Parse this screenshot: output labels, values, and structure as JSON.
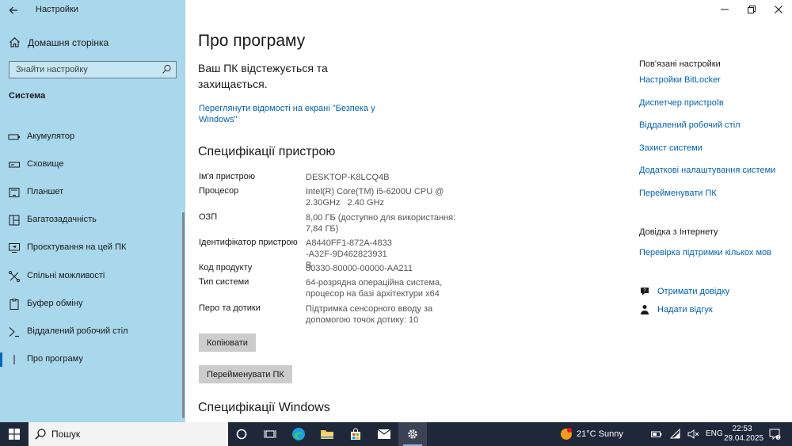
{
  "window": {
    "app_title": "Настройки",
    "controls": [
      "minimize",
      "restore",
      "close"
    ]
  },
  "sidebar": {
    "home_label": "Домашня сторінка",
    "search_placeholder": "Знайти настройку",
    "section": "Система",
    "items": [
      {
        "label": "Акумулятор",
        "icon": "battery-icon"
      },
      {
        "label": "Сховище",
        "icon": "storage-icon"
      },
      {
        "label": "Планшет",
        "icon": "tablet-icon"
      },
      {
        "label": "Багатозадачність",
        "icon": "multitasking-icon"
      },
      {
        "label": "Проєктування на цей ПК",
        "icon": "projecting-icon"
      },
      {
        "label": "Спільні можливості",
        "icon": "shared-experiences-icon"
      },
      {
        "label": "Буфер обміну",
        "icon": "clipboard-icon"
      },
      {
        "label": "Віддалений робочий стіл",
        "icon": "remote-desktop-icon"
      },
      {
        "label": "Про програму",
        "icon": "info-icon",
        "active": true
      }
    ]
  },
  "main": {
    "page_title": "Про програму",
    "protection_message": "Ваш ПК відстежується та захищається.",
    "security_link": "Переглянути відомості на екрані \"Безпека у Windows\"",
    "specs_title": "Специфікації пристрою",
    "specs": [
      {
        "key": "Ім'я пристрою",
        "value": "DESKTOP-K8LCQ4B"
      },
      {
        "key": "Процесор",
        "value": "Intel(R) Core(TM) i5-6200U CPU @ 2.30GHz   2.40 GHz"
      },
      {
        "key": "ОЗП",
        "value": "8,00 ГБ (доступно для використання: 7,84 ГБ)"
      },
      {
        "key": "Ідентифікатор пристрою",
        "value": "A8440FF1-872A-4833-A32F-9D462823931B"
      },
      {
        "key": "Код продукту",
        "value": "00330-80000-00000-AA211"
      },
      {
        "key": "Тип системи",
        "value": "64-розрядна операційна система, процесор на базі архітектури x64"
      },
      {
        "key": "Перо та дотики",
        "value": "Підтримка сенсорного вводу за допомогою точок дотику: 10"
      }
    ],
    "copy_button": "Копіювати",
    "rename_button": "Перейменувати ПК",
    "windows_specs_title": "Специфікації Windows"
  },
  "related": {
    "title": "Пов'язані настройки",
    "links": [
      "Настройки BitLocker",
      "Диспетчер пристроїв",
      "Віддалений робочий стіл",
      "Захист системи",
      "Додаткові налаштування системи",
      "Перейменувати ПК"
    ]
  },
  "help": {
    "title": "Довідка з Інтернету",
    "link": "Перевірка підтримки кількох мов",
    "get_help": "Отримати довідку",
    "feedback": "Надати відгук"
  },
  "taskbar": {
    "search_label": "Пошук",
    "weather": "21°C  Sunny",
    "language": "ENG",
    "time": "22:53",
    "date": "29.04.2025",
    "apps": [
      "cortana-icon",
      "task-view-icon",
      "edge-icon",
      "file-explorer-icon",
      "store-icon",
      "mail-icon",
      "settings-icon"
    ]
  },
  "colors": {
    "sidebar_bg": "#a9d7ec",
    "link": "#0063b1",
    "taskbar_bg": "#1f2838",
    "accent": "#0067c0"
  }
}
